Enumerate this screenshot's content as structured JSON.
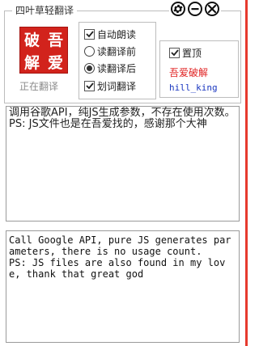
{
  "window": {
    "title": "四叶草轻翻译",
    "buttons": {
      "settings_icon": "gear-icon",
      "minimize_icon": "minus-icon",
      "close_icon": "close-icon"
    }
  },
  "logo": {
    "chars": [
      "破",
      "吾",
      "解",
      "爱"
    ],
    "color": "#d2231c"
  },
  "status": {
    "text": "正在翻译"
  },
  "options": {
    "auto_read": {
      "label": "自动朗读",
      "checked": true
    },
    "read_before": {
      "label": "读翻译前",
      "selected": false
    },
    "read_after": {
      "label": "读翻译后",
      "selected": true
    },
    "word_translate": {
      "label": "划词翻译",
      "checked": true
    }
  },
  "side": {
    "pin": {
      "label": "置顶",
      "checked": true
    },
    "credit_line1": "吾爱破解",
    "credit_line2": "hill_king"
  },
  "source_text": "调用谷歌API，纯JS生成参数，不存在使用次数。PS: JS文件也是在吾爱找的，感谢那个大神",
  "translated_text": "Call Google API, pure JS generates parameters, there is no usage count.\nPS: JS files are also found in my love, thank that great god",
  "colors": {
    "accent_red": "#e63a2e",
    "credit_blue": "#1a37c0"
  }
}
